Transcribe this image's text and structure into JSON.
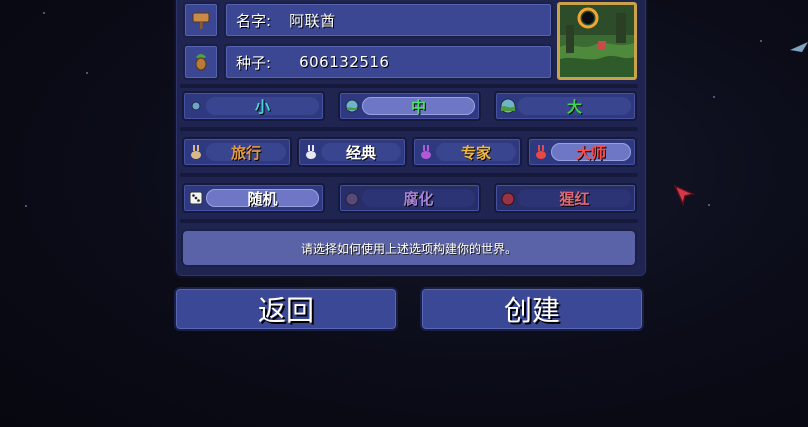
{
  "world": {
    "name_label": "名字:",
    "name_value": "阿联酋",
    "seed_label": "种子:",
    "seed_value": "606132516"
  },
  "size_options": [
    {
      "label": "小",
      "color": "#46d6e0",
      "selected": false,
      "icon": "small-world-icon"
    },
    {
      "label": "中",
      "color": "#4fe06a",
      "selected": true,
      "icon": "medium-world-icon"
    },
    {
      "label": "大",
      "color": "#3fd34f",
      "selected": false,
      "icon": "large-world-icon"
    }
  ],
  "difficulty_options": [
    {
      "label": "旅行",
      "color": "#e59a44",
      "selected": false,
      "icon": "bunny-journey-icon"
    },
    {
      "label": "经典",
      "color": "#ffffff",
      "selected": false,
      "icon": "bunny-classic-icon"
    },
    {
      "label": "专家",
      "color": "#f0b842",
      "selected": false,
      "icon": "bunny-expert-icon"
    },
    {
      "label": "大师",
      "color": "#ff4a4a",
      "selected": true,
      "icon": "bunny-master-icon"
    }
  ],
  "evil_options": [
    {
      "label": "随机",
      "color": "#ffffff",
      "selected": true,
      "icon": "dice-icon"
    },
    {
      "label": "腐化",
      "color": "#a884d8",
      "selected": false,
      "icon": "corruption-icon"
    },
    {
      "label": "猩红",
      "color": "#e06a78",
      "selected": false,
      "icon": "crimson-icon"
    }
  ],
  "description": "请选择如何使用上述选项构建你的世界。",
  "buttons": {
    "back": "返回",
    "create": "创建"
  }
}
